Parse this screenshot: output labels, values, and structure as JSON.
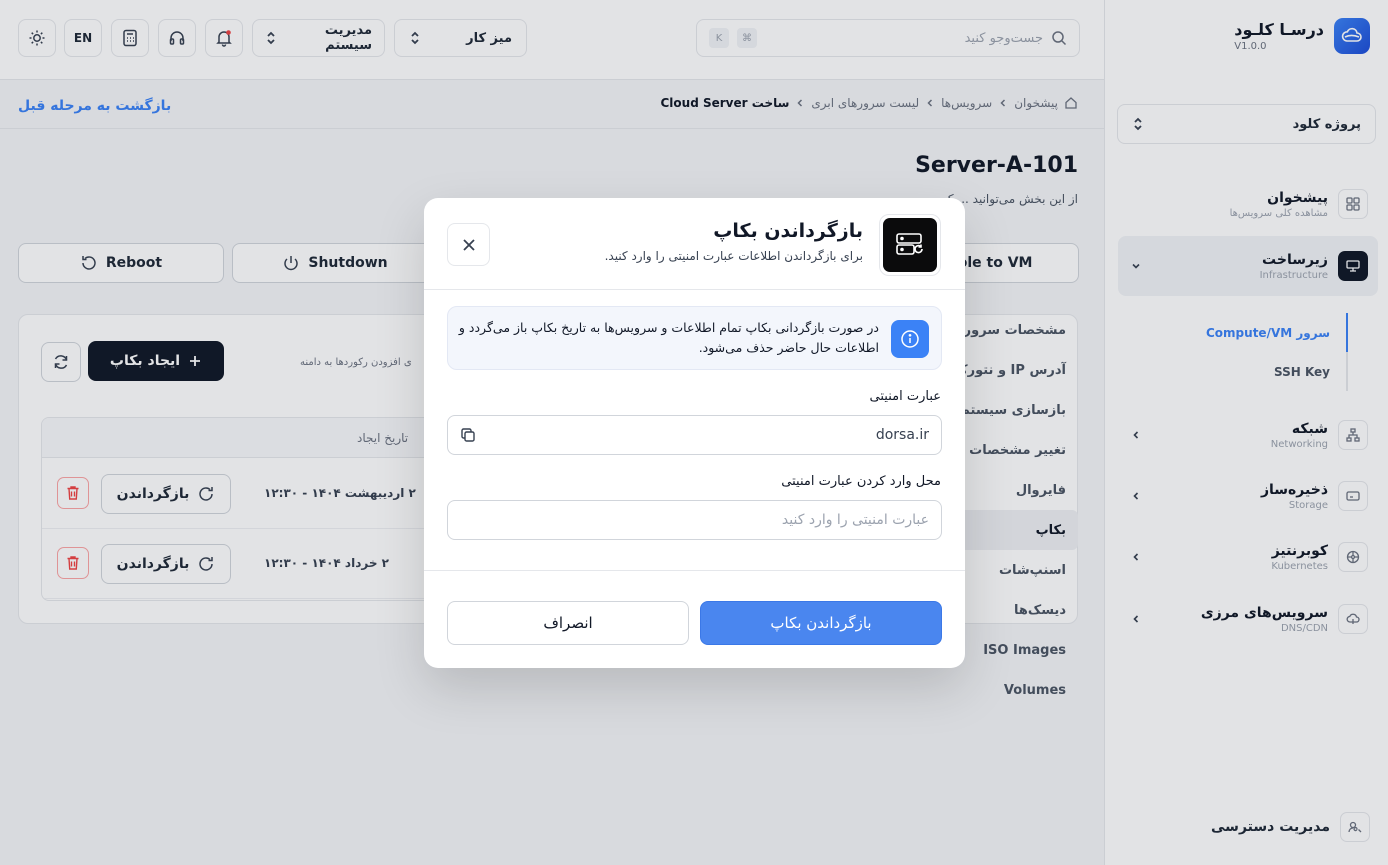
{
  "brand": {
    "name": "درسـا کلـود",
    "version": "V1.0.0"
  },
  "sidebar": {
    "project": "پروژه کلود",
    "items": [
      {
        "title": "پیشخوان",
        "sub": "مشاهده کلی سرویس‌ها"
      },
      {
        "title": "زیرساخت",
        "sub": "Infrastructure"
      },
      {
        "title": "شبکه",
        "sub": "Networking"
      },
      {
        "title": "ذخیره‌ساز",
        "sub": "Storage"
      },
      {
        "title": "کوبرنتیز",
        "sub": "Kubernetes"
      },
      {
        "title": "سرویس‌های مرزی",
        "sub": "DNS/CDN"
      }
    ],
    "subitems": [
      "سرور Compute/VM",
      "SSH Key"
    ],
    "access": "مدیریت دسترسی"
  },
  "topbar": {
    "search_placeholder": "جست‌وجو کنید",
    "kbd_cmd": "⌘",
    "kbd_k": "K",
    "workspace": "میز کار",
    "system": "مدیریت سیستم",
    "lang": "EN"
  },
  "breadcrumb": [
    "پیشخوان",
    "سرویس‌ها",
    "لیست سرورهای ابری",
    "ساخت Cloud Server"
  ],
  "back_label": "بازگشت به مرحله قبل",
  "server": {
    "title": "Server-A-101",
    "description": "از این بخش می‌توانید ... ک"
  },
  "actions": {
    "reboot": "Reboot",
    "shutdown": "Shutdown",
    "console": "Console to VM"
  },
  "tabs": [
    "مشخصات سرور",
    "آدرس IP و نتورک",
    "بازسازی سیستم عامل",
    "تغییر مشخصات سرور",
    "فایروال",
    "بکاپ",
    "اسنپ‌شات",
    "دیسک‌ها",
    "ISO Images",
    "Volumes"
  ],
  "backup": {
    "create_label": "ایجاد بکاپ",
    "hint": "ی افزودن رکوردها به دامنه",
    "col_created": "تاریخ ایجاد",
    "restore_label": "بازگرداندن",
    "rows": [
      {
        "date": "۲ اردیبهشت ۱۴۰۴ - ۱۲:۳۰"
      },
      {
        "date": "۲ خرداد ۱۴۰۴ - ۱۲:۳۰"
      }
    ]
  },
  "modal": {
    "title": "بازگرداندن بکاپ",
    "subtitle": "برای بازگرداندن اطلاعات عبارت امنیتی را وارد کنید.",
    "alert": "در صورت بازگردانی بکاپ تمام اطلاعات و سرویس‌ها به تاریخ بکاپ باز می‌گردد و اطلاعات حال حاضر حذف می‌شود.",
    "phrase_label": "عبارت امنیتی",
    "phrase_value": "dorsa.ir",
    "input_label": "محل وارد کردن عبارت امنیتی",
    "input_placeholder": "عبارت امنیتی را وارد کنید",
    "confirm": "بازگرداندن بکاپ",
    "cancel": "انصراف"
  },
  "colors": {
    "accent": "#4a86ef",
    "dark": "#111827",
    "danger": "#ef4444"
  }
}
